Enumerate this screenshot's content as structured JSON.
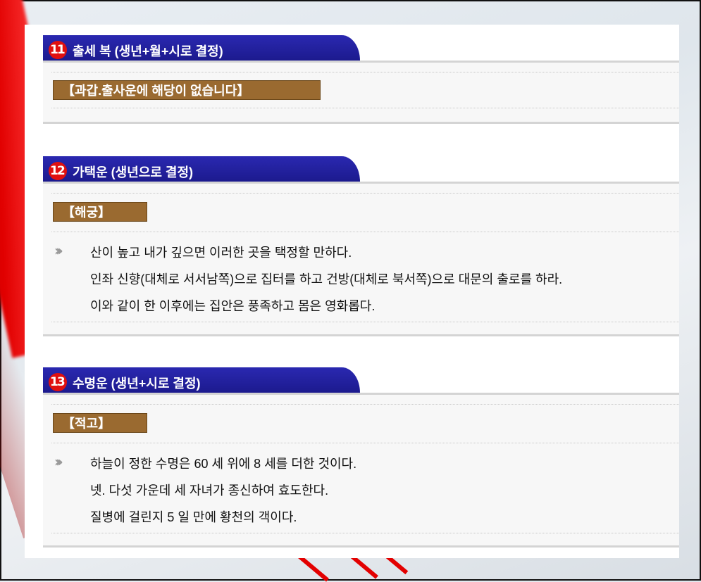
{
  "sections": [
    {
      "number": "11",
      "title": "출세 복 (생년+월+시로 결정)",
      "tag": "【과갑.출사운에 해당이 없습니다】",
      "lines": []
    },
    {
      "number": "12",
      "title": "가택운 (생년으로 결정)",
      "tag": "【해궁】",
      "lines": [
        "산이 높고 내가 깊으면 이러한 곳을 택정할 만하다.",
        "인좌 신향(대체로 서서남쪽)으로 집터를 하고 건방(대체로 북서쪽)으로 대문의 출로를 하라.",
        "이와 같이 한 이후에는 집안은 풍족하고 몸은 영화롭다."
      ]
    },
    {
      "number": "13",
      "title": "수명운 (생년+시로 결정)",
      "tag": "【적고】",
      "lines": [
        "하늘이 정한 수명은 60 세 위에 8 세를 더한 것이다.",
        "넷. 다섯 가운데 세 자녀가 종신하여 효도한다.",
        "질병에 걸린지 5 일 만에 황천의 객이다."
      ]
    }
  ],
  "bullet_icon": "double-chevron-right-icon",
  "colors": {
    "header": "#1c1a8e",
    "number_badge": "#e01010",
    "tag": "#9a6a30",
    "body_bg": "#f7f7f7"
  }
}
